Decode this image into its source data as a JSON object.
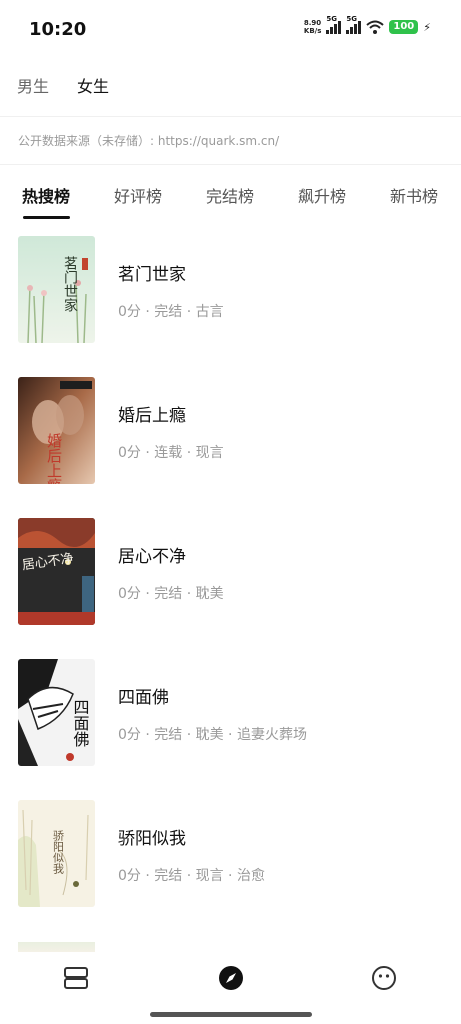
{
  "status": {
    "time": "10:20",
    "speed_value": "8.90",
    "speed_unit": "KB/s",
    "sig1_label": "5G",
    "sig2_label": "5G",
    "battery": "100"
  },
  "gender_tabs": [
    "男生",
    "女生"
  ],
  "source_note": "公开数据来源（未存储）: https://quark.sm.cn/",
  "rank_tabs": [
    "热搜榜",
    "好评榜",
    "完结榜",
    "飙升榜",
    "新书榜"
  ],
  "books": [
    {
      "title": "茗门世家",
      "meta": "0分 · 完结 · 古言",
      "cover_text": "茗门世家"
    },
    {
      "title": "婚后上瘾",
      "meta": "0分 · 连载 · 现言",
      "cover_text": "婚后上瘾"
    },
    {
      "title": "居心不净",
      "meta": "0分 · 完结 · 耽美",
      "cover_text": "居心不净"
    },
    {
      "title": "四面佛",
      "meta": "0分 · 完结 · 耽美 · 追妻火葬场",
      "cover_text": "四面佛"
    },
    {
      "title": "骄阳似我",
      "meta": "0分 · 完结 · 现言 · 治愈",
      "cover_text": "骄阳似我"
    }
  ],
  "colors": {
    "battery": "#2fc24b",
    "text_primary": "#111111",
    "text_secondary": "#9a9a9a"
  },
  "icons": {
    "nav_left": "bookshelf-icon",
    "nav_center": "compass-icon",
    "nav_right": "smiley-icon"
  }
}
